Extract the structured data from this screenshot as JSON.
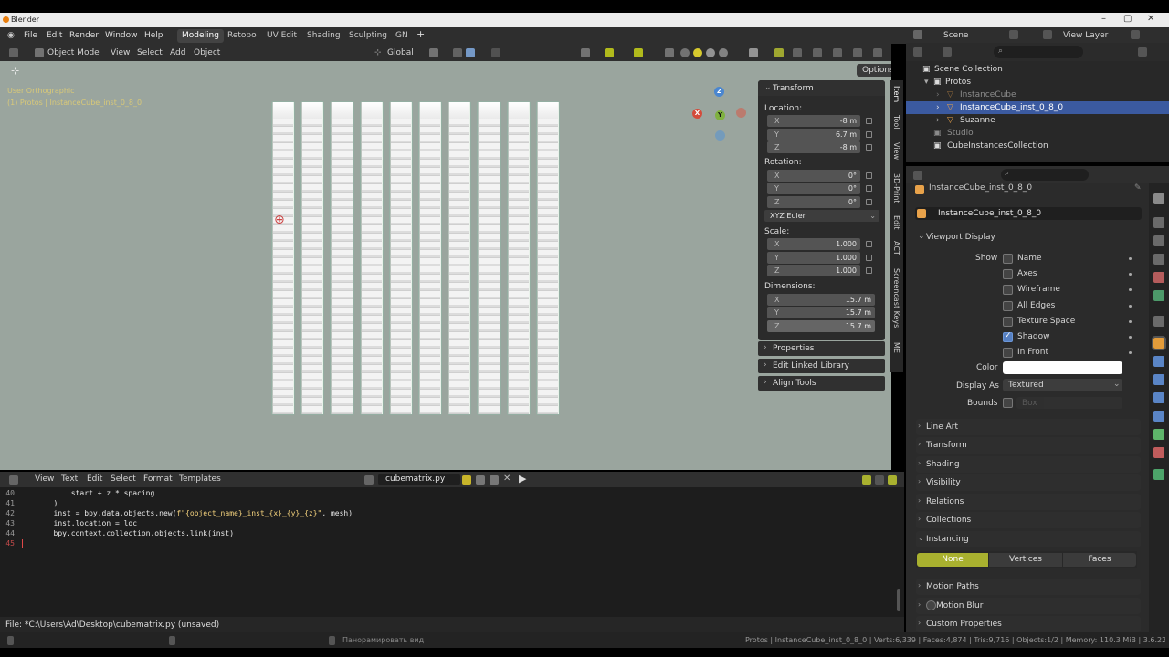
{
  "window": {
    "title": "Blender"
  },
  "menubar": {
    "items": [
      "File",
      "Edit",
      "Render",
      "Window",
      "Help"
    ],
    "workspaces": [
      "Modeling",
      "Retopo",
      "UV Edit",
      "Shading",
      "Sculpting",
      "GN"
    ],
    "active_workspace": "Modeling",
    "scene": "Scene",
    "view_layer": "View Layer"
  },
  "viewport": {
    "mode": "Object Mode",
    "menus": [
      "View",
      "Select",
      "Add",
      "Object"
    ],
    "orientation": "Global",
    "overlay_view": "User Orthographic",
    "overlay_obj": "(1) Protos | InstanceCube_inst_0_8_0",
    "options_label": "Options",
    "gizmo": {
      "x": "X",
      "y": "Y",
      "z": "Z"
    },
    "grid_columns": 10
  },
  "npanel": {
    "transform_title": "Transform",
    "location_label": "Location:",
    "location": {
      "x": "-8 m",
      "y": "6.7 m",
      "z": "-8 m"
    },
    "rotation_label": "Rotation:",
    "rotation": {
      "x": "0°",
      "y": "0°",
      "z": "0°"
    },
    "rotation_mode": "XYZ Euler",
    "scale_label": "Scale:",
    "scale": {
      "x": "1.000",
      "y": "1.000",
      "z": "1.000"
    },
    "dimensions_label": "Dimensions:",
    "dimensions": {
      "x": "15.7 m",
      "y": "15.7 m",
      "z": "15.7 m"
    },
    "axis": {
      "x": "X",
      "y": "Y",
      "z": "Z"
    },
    "subpanels": [
      "Properties",
      "Edit Linked Library",
      "Align Tools"
    ],
    "tabs": [
      "Item",
      "Tool",
      "View",
      "3D-Print",
      "Edit",
      "ACT",
      "Screencast Keys",
      "ME"
    ]
  },
  "text_editor": {
    "menus": [
      "View",
      "Text",
      "Edit",
      "Select",
      "Format",
      "Templates"
    ],
    "filename": "cubematrix.py",
    "lines": [
      {
        "n": "40",
        "code": "            start + z * spacing"
      },
      {
        "n": "41",
        "code": "        )"
      },
      {
        "n": "42",
        "pre": "        inst = bpy.data.objects.new(",
        "str": "f\"{object_name}_inst_{x}_{y}_{z}\"",
        "post": ", mesh)"
      },
      {
        "n": "43",
        "code": "        inst.location = loc"
      },
      {
        "n": "44",
        "code": "        bpy.context.collection.objects.link(inst)"
      },
      {
        "n": "45",
        "code": ""
      }
    ],
    "file_status": "File: *C:\\Users\\Ad\\Desktop\\cubematrix.py (unsaved)"
  },
  "statusbar": {
    "hint": "Панорамировать вид",
    "stats": "Protos | InstanceCube_inst_0_8_0 | Verts:6,339 | Faces:4,874 | Tris:9,716 | Objects:1/2 | Memory: 110.3 MiB | 3.6.22"
  },
  "outliner": {
    "rows": [
      {
        "label": "Scene Collection"
      },
      {
        "label": "Protos"
      },
      {
        "label": "InstanceCube"
      },
      {
        "label": "InstanceCube_inst_0_8_0"
      },
      {
        "label": "Suzanne"
      },
      {
        "label": "Studio"
      },
      {
        "label": "CubeInstancesCollection"
      }
    ]
  },
  "properties": {
    "object_name": "InstanceCube_inst_0_8_0",
    "object_name2": "InstanceCube_inst_0_8_0",
    "viewport_display": "Viewport Display",
    "show_label": "Show",
    "show_options": [
      {
        "label": "Name",
        "checked": false
      },
      {
        "label": "Axes",
        "checked": false
      },
      {
        "label": "Wireframe",
        "checked": false
      },
      {
        "label": "All Edges",
        "checked": false
      },
      {
        "label": "Texture Space",
        "checked": false
      },
      {
        "label": "Shadow",
        "checked": true
      },
      {
        "label": "In Front",
        "checked": false
      }
    ],
    "color_label": "Color",
    "display_as_label": "Display As",
    "display_as": "Textured",
    "bounds_label": "Bounds",
    "bounds_value": "Box",
    "sections": [
      "Line Art",
      "Transform",
      "Shading",
      "Visibility",
      "Relations",
      "Collections",
      "Instancing"
    ],
    "instancing": [
      "None",
      "Vertices",
      "Faces"
    ],
    "sections2": [
      "Motion Paths",
      "Motion Blur",
      "Custom Properties"
    ]
  }
}
